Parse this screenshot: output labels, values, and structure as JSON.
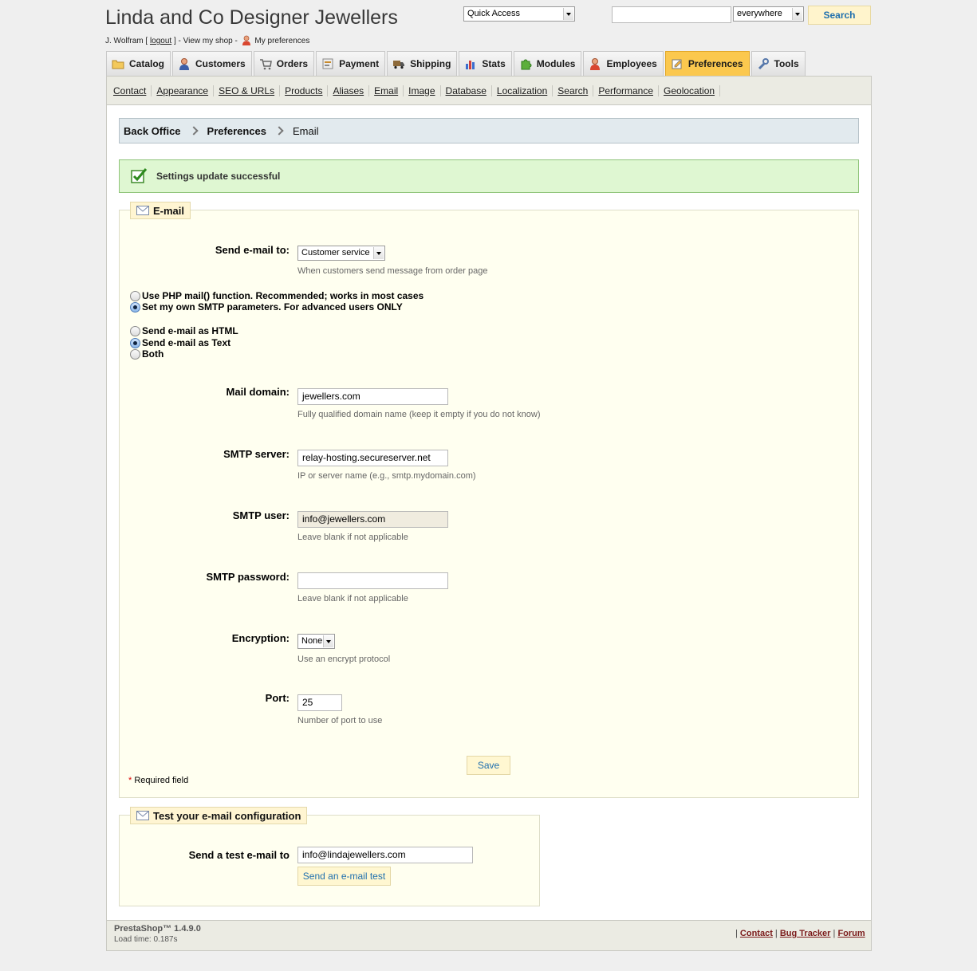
{
  "header": {
    "title": "Linda and Co Designer Jewellers",
    "user_name": "J. Wolfram",
    "logout": "logout",
    "view_shop": "View my shop",
    "my_preferences": "My preferences",
    "quick_access": "Quick Access",
    "search_value": "",
    "search_scope": "everywhere",
    "search_button": "Search"
  },
  "tabs": [
    {
      "label": "Catalog",
      "icon": "folder-icon"
    },
    {
      "label": "Customers",
      "icon": "user-icon"
    },
    {
      "label": "Orders",
      "icon": "cart-icon"
    },
    {
      "label": "Payment",
      "icon": "payment-icon"
    },
    {
      "label": "Shipping",
      "icon": "truck-icon"
    },
    {
      "label": "Stats",
      "icon": "chart-icon"
    },
    {
      "label": "Modules",
      "icon": "puzzle-icon"
    },
    {
      "label": "Employees",
      "icon": "employee-icon"
    },
    {
      "label": "Preferences",
      "icon": "preferences-icon",
      "active": true
    },
    {
      "label": "Tools",
      "icon": "wrench-icon"
    }
  ],
  "subnav": [
    "Contact",
    "Appearance",
    "SEO & URLs",
    "Products",
    "Aliases",
    "Email",
    "Image",
    "Database",
    "Localization",
    "Search",
    "Performance",
    "Geolocation"
  ],
  "breadcrumb": [
    "Back Office",
    "Preferences",
    "Email"
  ],
  "success_message": "Settings update successful",
  "email_form": {
    "legend": "E-mail",
    "send_to_label": "Send e-mail to:",
    "send_to_value": "Customer service",
    "send_to_hint": "When customers send message from order page",
    "method_options": [
      {
        "label": "Use PHP mail() function. Recommended; works in most cases",
        "checked": false
      },
      {
        "label": "Set my own SMTP parameters. For advanced users ONLY",
        "checked": true
      }
    ],
    "format_options": [
      {
        "label": "Send e-mail as HTML",
        "checked": false
      },
      {
        "label": "Send e-mail as Text",
        "checked": true
      },
      {
        "label": "Both",
        "checked": false
      }
    ],
    "mail_domain_label": "Mail domain:",
    "mail_domain_value": "jewellers.com",
    "mail_domain_hint": "Fully qualified domain name (keep it empty if you do not know)",
    "smtp_server_label": "SMTP server:",
    "smtp_server_value": "relay-hosting.secureserver.net",
    "smtp_server_hint": "IP or server name (e.g., smtp.mydomain.com)",
    "smtp_user_label": "SMTP user:",
    "smtp_user_value": "info@jewellers.com",
    "smtp_user_hint": "Leave blank if not applicable",
    "smtp_password_label": "SMTP password:",
    "smtp_password_value": "",
    "smtp_password_hint": "Leave blank if not applicable",
    "encryption_label": "Encryption:",
    "encryption_value": "None",
    "encryption_hint": "Use an encrypt protocol",
    "port_label": "Port:",
    "port_value": "25",
    "port_hint": "Number of port to use",
    "save_button": "Save",
    "required_note": "Required field"
  },
  "test_form": {
    "legend": "Test your e-mail configuration",
    "label": "Send a test e-mail to",
    "value": "info@lindajewellers.com",
    "button": "Send an e-mail test"
  },
  "footer": {
    "version": "PrestaShop™ 1.4.9.0",
    "load_time": "Load time: 0.187s",
    "links": [
      "Contact",
      "Bug Tracker",
      "Forum"
    ]
  },
  "colors": {
    "active_tab": "#fbc84e",
    "success_bg": "#dff7d2",
    "fieldset_bg": "#fffff0",
    "link_blue": "#1f6fae"
  }
}
